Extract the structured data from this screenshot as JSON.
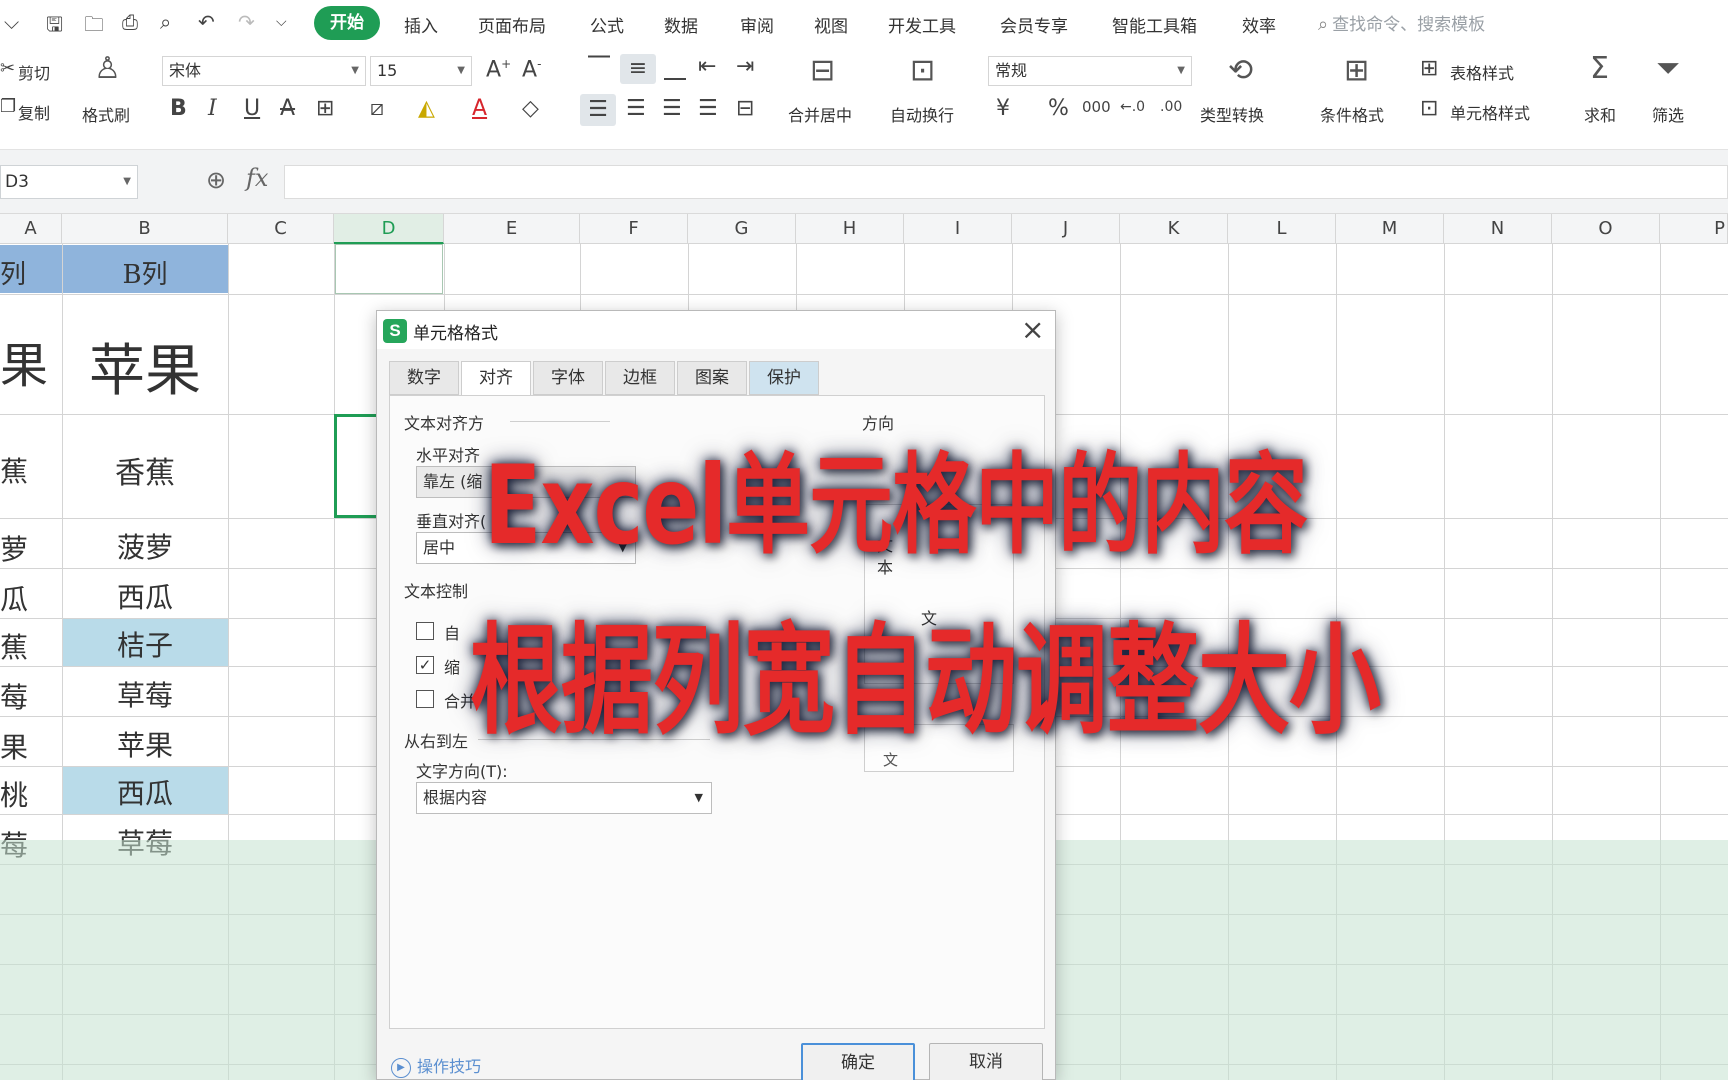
{
  "menubar": {
    "quick_access": [
      "⌵",
      "🖫",
      "🗀",
      "⎙",
      "⌕",
      "↶",
      "↷",
      "⌵"
    ],
    "items": [
      "开始",
      "插入",
      "页面布局",
      "公式",
      "数据",
      "审阅",
      "视图",
      "开发工具",
      "会员专享",
      "智能工具箱",
      "效率"
    ],
    "search_placeholder": "查找命令、搜索模板"
  },
  "ribbon": {
    "cut_label": "剪切",
    "copy_label": "复制",
    "format_painter_label": "格式刷",
    "font_name": "宋体",
    "font_size": "15",
    "bold": "B",
    "italic": "I",
    "underline": "U",
    "merge_center_label": "合并居中",
    "wrap_text_label": "自动换行",
    "number_format": "常规",
    "currency": "¥",
    "percent": "%",
    "thousands": "000",
    "inc_decimal": "←.0",
    "dec_decimal": ".00",
    "type_convert_label": "类型转换",
    "conditional_format_label": "条件格式",
    "table_style_label": "表格样式",
    "cell_style_label": "单元格样式",
    "sum_label": "求和",
    "filter_label": "筛选"
  },
  "formula_bar": {
    "name_box": "D3",
    "fx": "fx"
  },
  "grid": {
    "columns": [
      "A",
      "B",
      "C",
      "D",
      "E",
      "F",
      "G",
      "H",
      "I",
      "J",
      "K",
      "L",
      "M",
      "N",
      "O",
      "P"
    ],
    "selected_column": "D",
    "col_a_partial": [
      "列",
      "果",
      "蕉",
      "萝",
      "瓜",
      "蕉",
      "莓",
      "果",
      "桃",
      "莓"
    ],
    "col_b": [
      "B列",
      "苹果",
      "香蕉",
      "菠萝",
      "西瓜",
      "桔子",
      "草莓",
      "苹果",
      "西瓜",
      "草莓"
    ],
    "colors": {
      "header_fill": "#8fb4dc",
      "highlight_fill": "#b9dbe9",
      "selection": "#1f9d55"
    }
  },
  "dialog": {
    "title": "单元格格式",
    "tabs": [
      "数字",
      "对齐",
      "字体",
      "边框",
      "图案",
      "保护"
    ],
    "active_tab": "对齐",
    "text_alignment_label": "文本对齐方",
    "horizontal_label": "水平对齐",
    "horizontal_value": "靠左 (缩",
    "vertical_label": "垂直对齐(",
    "vertical_value": "居中",
    "orientation_label": "方向",
    "orientation_vertical_text": "文本",
    "orientation_text": "文",
    "text_control_label": "文本控制",
    "wrap_partial": "自",
    "shrink_partial": "缩",
    "merge_partial": "合并",
    "degree_partial": "文",
    "rtl_label": "从右到左",
    "text_direction_label": "文字方向(T):",
    "text_direction_value": "根据内容",
    "tips_label": "操作技巧",
    "ok_label": "确定",
    "cancel_label": "取消"
  },
  "caption": {
    "line1": "Excel单元格中的内容",
    "line2": "根据列宽自动调整大小",
    "color": "#e52a2a"
  }
}
